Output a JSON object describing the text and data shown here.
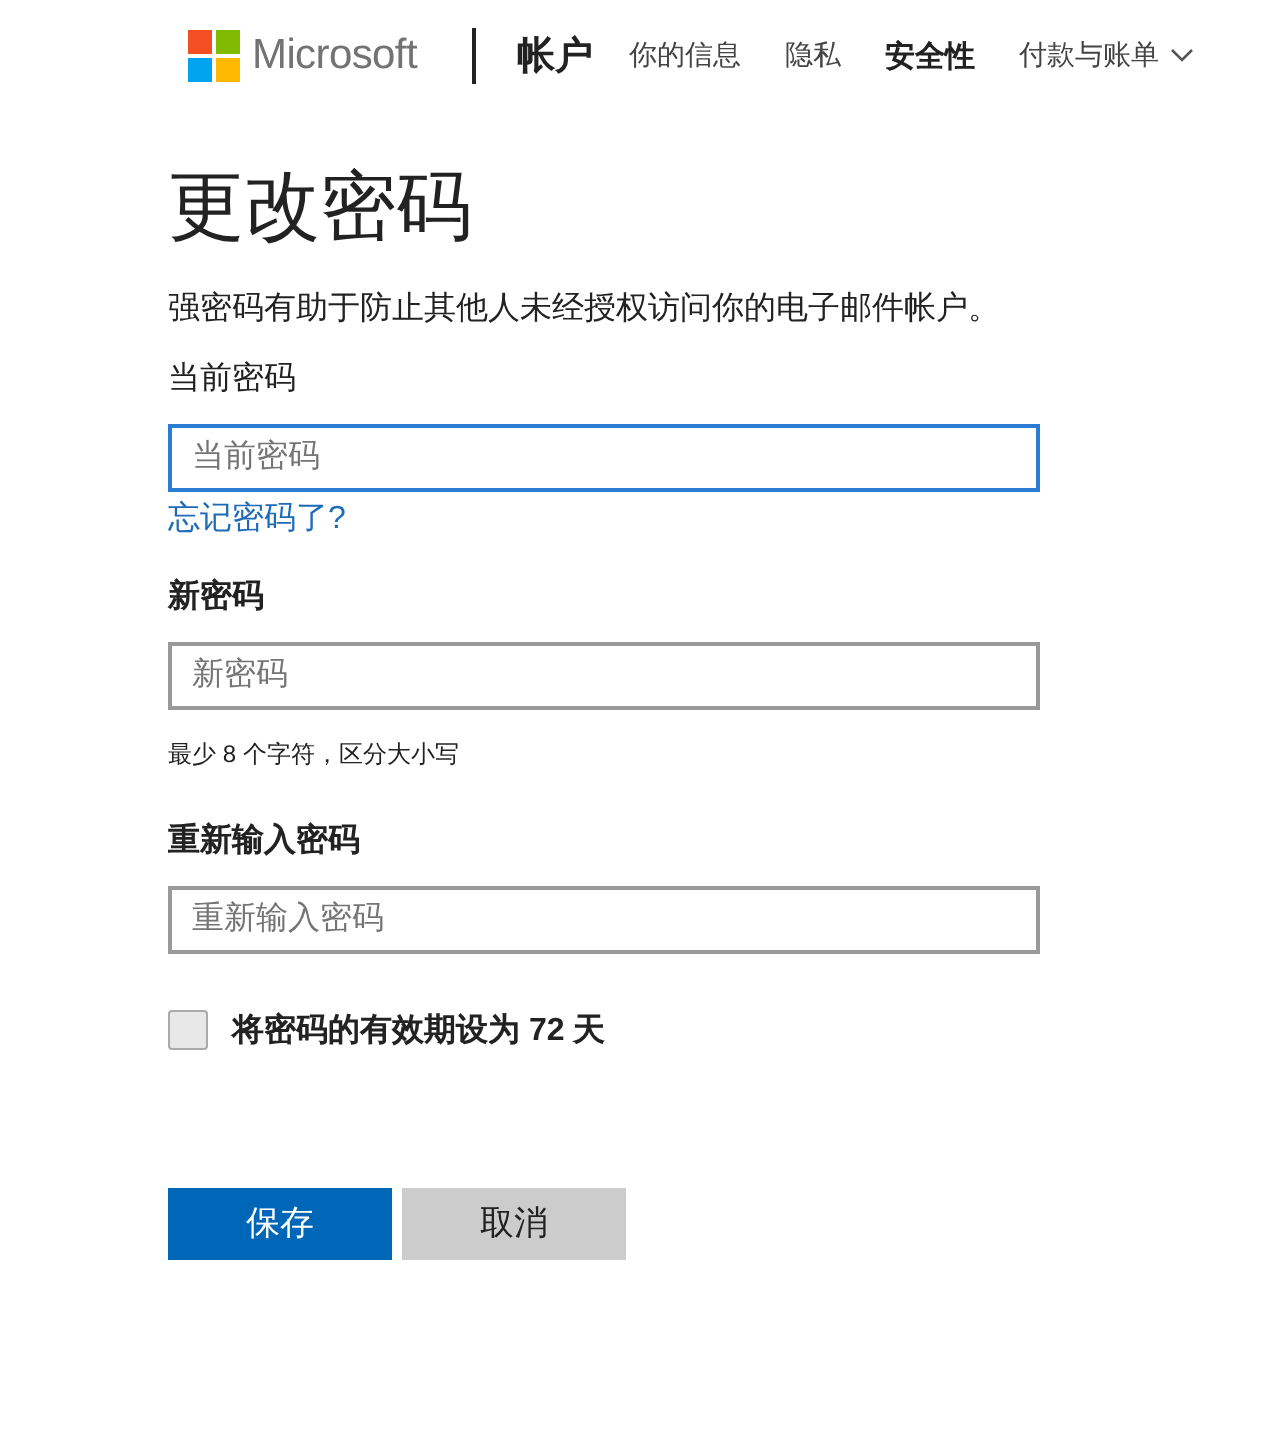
{
  "header": {
    "brand": "Microsoft",
    "section": "帐户",
    "nav": [
      {
        "label": "你的信息",
        "selected": false,
        "kind": "link"
      },
      {
        "label": "隐私",
        "selected": false,
        "kind": "link"
      },
      {
        "label": "安全性",
        "selected": true,
        "kind": "link"
      },
      {
        "label": "付款与账单",
        "selected": false,
        "kind": "menu"
      }
    ]
  },
  "title": "更改密码",
  "description": "强密码有助于防止其他人未经授权访问你的电子邮件帐户。",
  "fields": [
    {
      "label": "当前密码",
      "label_bold": false,
      "placeholder": "当前密码",
      "focused": true,
      "link": "忘记密码了?"
    },
    {
      "label": "新密码",
      "label_bold": true,
      "placeholder": "新密码",
      "focused": false,
      "hint": "最少 8 个字符，区分大小写"
    },
    {
      "label": "重新输入密码",
      "label_bold": true,
      "placeholder": "重新输入密码",
      "focused": false
    }
  ],
  "expiry_checkbox": {
    "label": "将密码的有效期设为 72 天",
    "checked": false
  },
  "buttons": [
    {
      "label": "保存",
      "kind": "primary"
    },
    {
      "label": "取消",
      "kind": "secondary"
    }
  ]
}
